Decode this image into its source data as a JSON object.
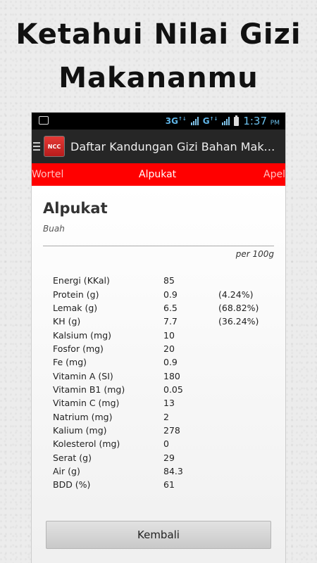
{
  "promo": {
    "line1": "Ketahui Nilai Gizi",
    "line2": "Makananmu"
  },
  "statusbar": {
    "time": "1:37",
    "ampm": "PM",
    "net1": "3G",
    "net2": "G"
  },
  "actionbar": {
    "app_icon_text": "NCC",
    "title": "Daftar Kandungan Gizi Bahan Maka…"
  },
  "tabs": {
    "prev": "Wortel",
    "current": "Alpukat",
    "next": "Apel"
  },
  "food": {
    "name": "Alpukat",
    "category": "Buah",
    "per": "per 100g"
  },
  "nutrients": [
    {
      "label": "Energi (KKal)",
      "value": "85",
      "pct": ""
    },
    {
      "label": "Protein (g)",
      "value": "0.9",
      "pct": "(4.24%)"
    },
    {
      "label": "Lemak (g)",
      "value": "6.5",
      "pct": "(68.82%)"
    },
    {
      "label": "KH (g)",
      "value": "7.7",
      "pct": "(36.24%)"
    },
    {
      "label": "Kalsium (mg)",
      "value": "10",
      "pct": ""
    },
    {
      "label": "Fosfor (mg)",
      "value": "20",
      "pct": ""
    },
    {
      "label": "Fe (mg)",
      "value": "0.9",
      "pct": ""
    },
    {
      "label": "Vitamin A (SI)",
      "value": "180",
      "pct": ""
    },
    {
      "label": "Vitamin B1 (mg)",
      "value": "0.05",
      "pct": ""
    },
    {
      "label": "Vitamin C (mg)",
      "value": "13",
      "pct": ""
    },
    {
      "label": "Natrium (mg)",
      "value": "2",
      "pct": ""
    },
    {
      "label": "Kalium (mg)",
      "value": "278",
      "pct": ""
    },
    {
      "label": "Kolesterol (mg)",
      "value": "0",
      "pct": ""
    },
    {
      "label": "Serat (g)",
      "value": "29",
      "pct": ""
    },
    {
      "label": "Air (g)",
      "value": "84.3",
      "pct": ""
    },
    {
      "label": "BDD (%)",
      "value": "61",
      "pct": ""
    }
  ],
  "button": {
    "label": "Kembali"
  },
  "colors": {
    "tab_bar": "#ff0000",
    "action_bar": "#262626",
    "status_accent": "#5fb4e6"
  }
}
